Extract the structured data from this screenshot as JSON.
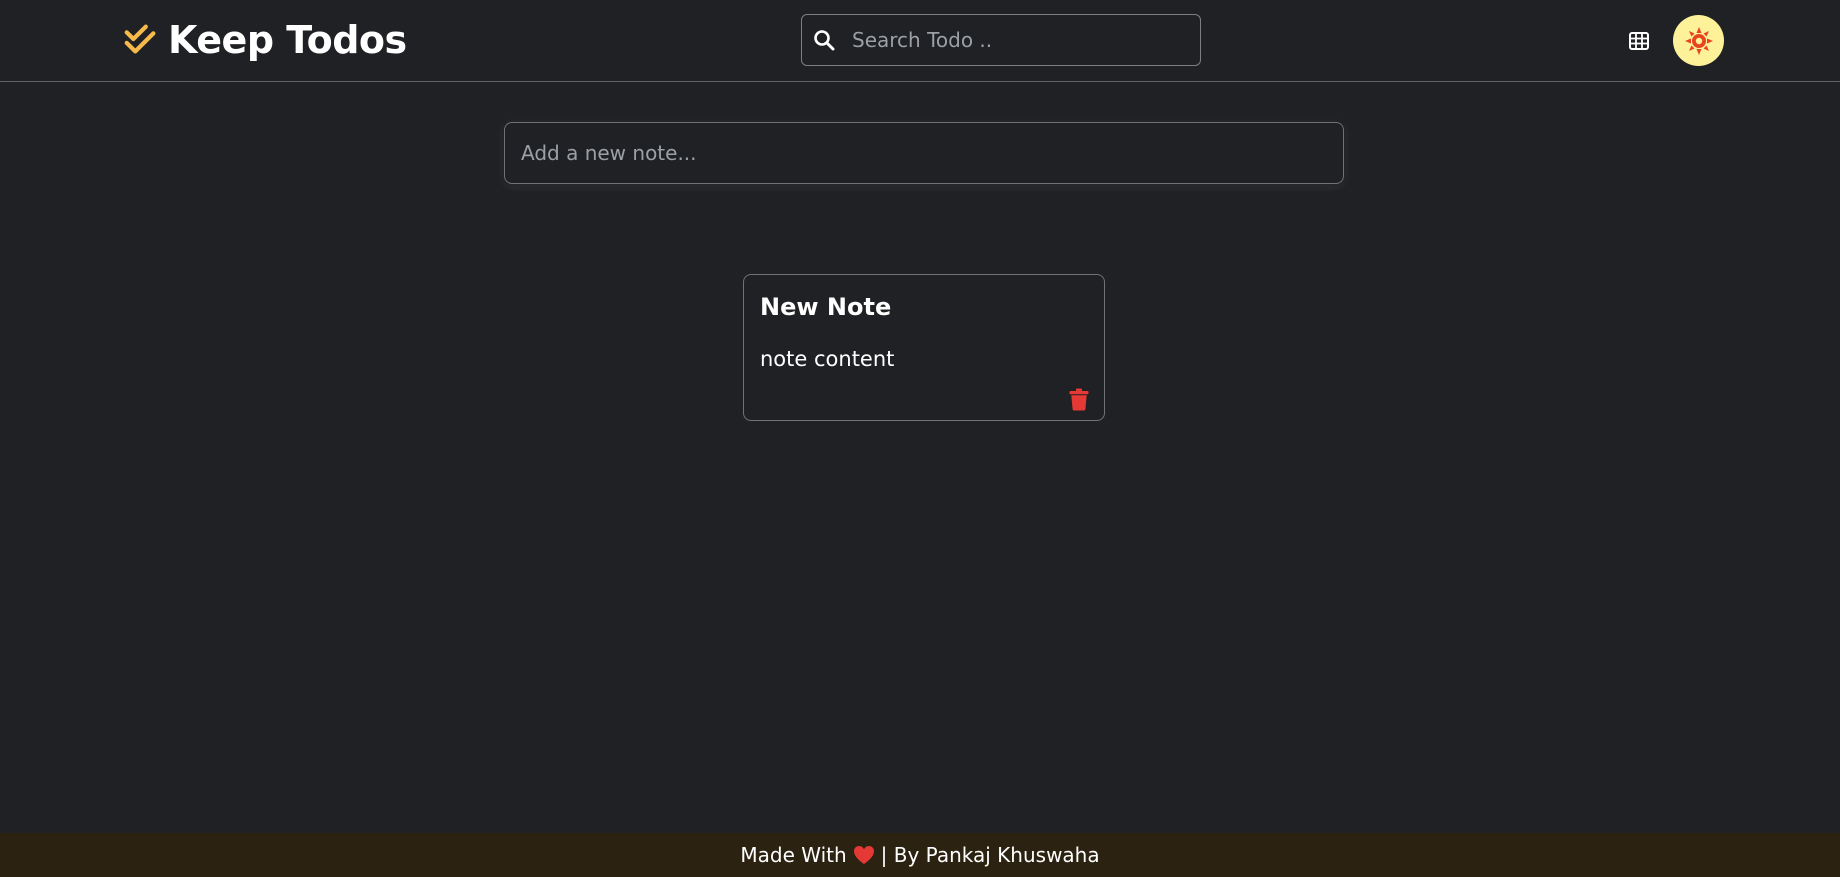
{
  "app": {
    "title": "Keep Todos",
    "brand_icon": "double-check-icon",
    "accent_color": "#f6b94c"
  },
  "header": {
    "search": {
      "placeholder": "Search Todo ..",
      "value": "",
      "icon": "search-icon"
    },
    "grid_toggle_icon": "grid-view-icon",
    "theme_toggle_icon": "sun-icon",
    "theme_toggle_bg": "#fdf19a"
  },
  "add_note": {
    "placeholder": "Add a new note...",
    "value": ""
  },
  "notes": [
    {
      "title": "New Note",
      "content": "note content",
      "delete_icon": "trash-icon",
      "delete_color": "#e53935"
    }
  ],
  "footer": {
    "prefix": "Made With",
    "heart_icon": "heart-icon",
    "suffix": "| By Pankaj Khuswaha",
    "bg_color": "#2c2211"
  }
}
